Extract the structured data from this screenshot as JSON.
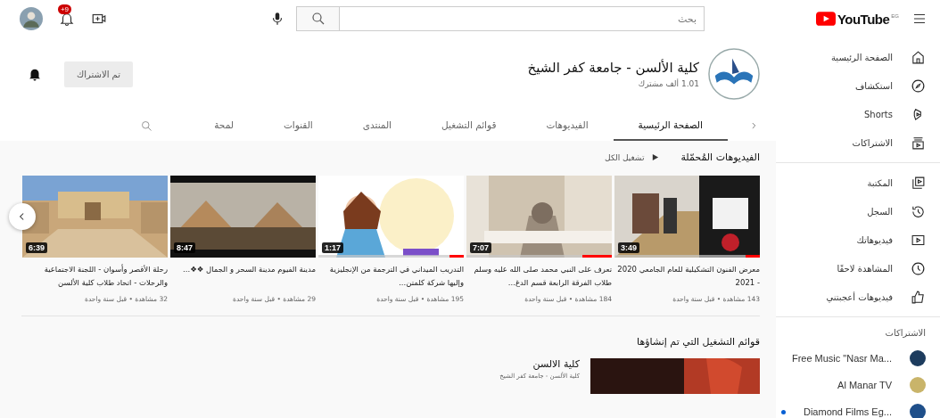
{
  "topbar": {
    "logo": "YouTube",
    "region": "EG",
    "search": {
      "placeholder": "بحث"
    },
    "notifications": "+9"
  },
  "sidebar": {
    "groups": [
      [
        {
          "label": "الصفحة الرئيسية"
        },
        {
          "label": "استكشاف"
        },
        {
          "label": "Shorts"
        },
        {
          "label": "الاشتراكات"
        }
      ],
      [
        {
          "label": "المكتبة"
        },
        {
          "label": "السجل"
        },
        {
          "label": "فيديوهاتك"
        },
        {
          "label": "المشاهدة لاحقًا"
        },
        {
          "label": "فيديوهات أعجبتني"
        }
      ]
    ],
    "subscriptions_title": "الاشتراكات",
    "subscriptions": [
      {
        "name": "Free Music \"Nasr Ma...",
        "new": false,
        "color": "#1d3c5e"
      },
      {
        "name": "Al Manar TV",
        "new": false,
        "color": "#c9b46a"
      },
      {
        "name": "Diamond Films Eg...",
        "new": true,
        "color": "#1f4f8a"
      }
    ]
  },
  "channel": {
    "name": "كلية الألسن - جامعة كفر الشيخ",
    "subscribers": "1.01 ألف مشترك",
    "subscribe_button": "تم الاشتراك"
  },
  "tabs": [
    {
      "label": "الصفحة الرئيسية",
      "selected": true
    },
    {
      "label": "الفيديوهات",
      "selected": false
    },
    {
      "label": "قوائم التشغيل",
      "selected": false
    },
    {
      "label": "المنتدى",
      "selected": false
    },
    {
      "label": "القنوات",
      "selected": false
    },
    {
      "label": "لمحة",
      "selected": false
    }
  ],
  "uploads": {
    "title": "الفيديوهات المُحمّلة",
    "play_all": "تشغيل الكل",
    "videos": [
      {
        "duration": "3:49",
        "title": "معرض الفنون التشكيلية للعام الجامعي 2020 - 2021",
        "meta": "143 مشاهدة • قبل سنة واحدة",
        "level": 0.1
      },
      {
        "duration": "7:07",
        "title": "تعرف على النبي محمد صلى الله عليه وسلم طلاب الفرقة الرابعة قسم الدغ...",
        "meta": "184 مشاهدة • قبل سنة واحدة",
        "level": 0.2
      },
      {
        "duration": "1:17",
        "title": "التدريب الميداني في الترجمة من الإنجليزية وإليها شركة كلمتن...",
        "meta": "195 مشاهدة • قبل سنة واحدة",
        "level": 0.1
      },
      {
        "duration": "8:47",
        "title": "مدينة الفيوم مدينة السحر و الجمال ❖❖...",
        "meta": "29 مشاهدة • قبل سنة واحدة"
      },
      {
        "duration": "6:39",
        "title": "رحلة الأقصر وأسوان - اللجنة الاجتماعية والرحلات - اتحاد طلاب كلية الألسن",
        "meta": "32 مشاهدة • قبل سنة واحدة"
      }
    ]
  },
  "playlists": {
    "title": "قوائم التشغيل التي تم إنشاؤها",
    "items": [
      {
        "title": "كلية الالسن",
        "channel": "كلية الألسن - جامعة كفر الشيخ"
      }
    ]
  }
}
